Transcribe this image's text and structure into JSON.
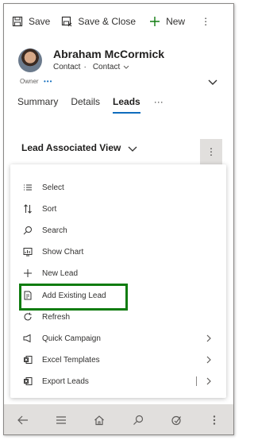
{
  "toolbar": {
    "save_label": "Save",
    "save_close_label": "Save & Close",
    "new_label": "New",
    "more_label": "⋮"
  },
  "record": {
    "name": "Abraham McCormick",
    "entity_label": "Contact",
    "separator": "·",
    "form_selector": "Contact",
    "owner_label": "Owner",
    "owner_value": "•••"
  },
  "tabs": [
    {
      "label": "Summary",
      "active": false
    },
    {
      "label": "Details",
      "active": false
    },
    {
      "label": "Leads",
      "active": true
    },
    {
      "label": "···",
      "active": false
    }
  ],
  "subgrid": {
    "view_title": "Lead Associated View",
    "more_label": "⋮"
  },
  "menu": {
    "items": [
      {
        "label": "Select",
        "icon": "list-select-icon"
      },
      {
        "label": "Sort",
        "icon": "sort-icon"
      },
      {
        "label": "Search",
        "icon": "search-icon"
      },
      {
        "label": "Show Chart",
        "icon": "chart-icon"
      },
      {
        "label": "New Lead",
        "icon": "plus-icon"
      },
      {
        "label": "Add Existing Lead",
        "icon": "add-existing-icon",
        "highlighted": true
      },
      {
        "label": "Refresh",
        "icon": "refresh-icon"
      },
      {
        "label": "Quick Campaign",
        "icon": "campaign-icon",
        "submenu": true
      },
      {
        "label": "Excel Templates",
        "icon": "excel-icon",
        "submenu": true
      },
      {
        "label": "Export Leads",
        "icon": "excel-export-icon",
        "submenu": true,
        "split": true
      }
    ]
  },
  "bottom_nav": [
    "back-icon",
    "hamburger-icon",
    "home-icon",
    "search-icon",
    "activity-icon",
    "more-vertical-icon"
  ],
  "colors": {
    "accent": "#0f6cbd",
    "highlight_border": "#107c10",
    "bottom_bar": "#e1dfdd"
  }
}
